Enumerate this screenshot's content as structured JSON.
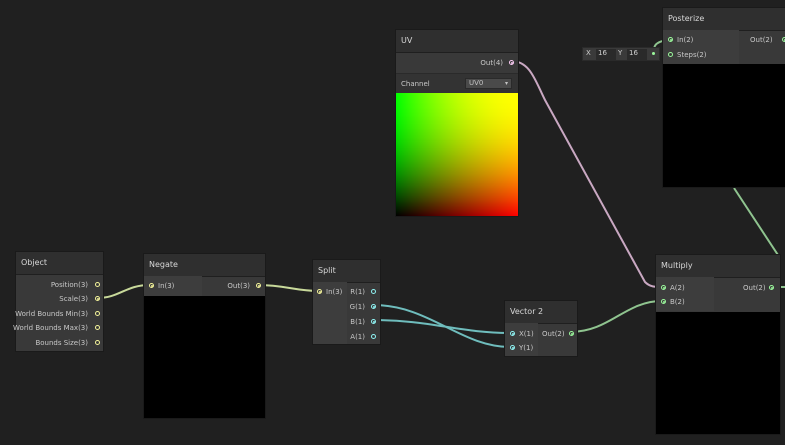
{
  "colors": {
    "background": "#202020",
    "vector3": "#f4f49a",
    "vector1": "#8ff3f3",
    "vector4": "#fbcbf4",
    "vector2": "#9bf89c"
  },
  "nodes": {
    "object": {
      "title": "Object",
      "outputs": [
        "Position(3)",
        "Scale(3)",
        "World Bounds Min(3)",
        "World Bounds Max(3)",
        "Bounds Size(3)"
      ]
    },
    "negate": {
      "title": "Negate",
      "input": "In(3)",
      "output": "Out(3)"
    },
    "split": {
      "title": "Split",
      "input": "In(3)",
      "outputs": [
        "R(1)",
        "G(1)",
        "B(1)",
        "A(1)"
      ]
    },
    "uv": {
      "title": "UV",
      "output": "Out(4)",
      "channel_label": "Channel",
      "channel_value": "UV0"
    },
    "vector2": {
      "title": "Vector 2",
      "inputs": [
        "X(1)",
        "Y(1)"
      ],
      "output": "Out(2)"
    },
    "posterize": {
      "title": "Posterize",
      "inputs": [
        "In(2)",
        "Steps(2)"
      ],
      "output": "Out(2)",
      "steps_x_label": "X",
      "steps_x_value": "16",
      "steps_y_label": "Y",
      "steps_y_value": "16"
    },
    "multiply": {
      "title": "Multiply",
      "inputs": [
        "A(2)",
        "B(2)"
      ],
      "output": "Out(2)"
    }
  }
}
